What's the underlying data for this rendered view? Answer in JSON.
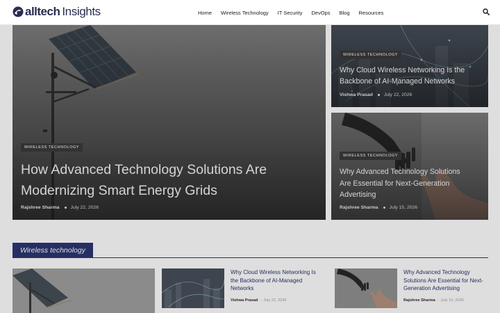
{
  "header": {
    "logo_bold": "alltech",
    "logo_light": "Insights",
    "nav": [
      "Home",
      "Wireless Technology",
      "IT Security",
      "DevOps",
      "Blog",
      "Resources"
    ]
  },
  "hero": {
    "main": {
      "badge": "WIRELESS TECHNOLOGY",
      "title_line1": "How Advanced Technology Solutions Are",
      "title_line2": "Modernizing Smart Energy Grids",
      "author": "Rajshree Sharma",
      "date": "July 22, 2026"
    },
    "top_right": {
      "badge": "WIRELESS TECHNOLOGY",
      "title_line1": "Why Cloud Wireless Networking Is the",
      "title_line2": "Backbone of AI-Managed Networks",
      "author": "Vishwa Prasad",
      "date": "July 22, 2026"
    },
    "bottom_right": {
      "badge": "WIRELESS TECHNOLOGY",
      "title_line1": "Why Advanced Technology Solutions",
      "title_line2": "Are Essential for Next-Generation",
      "title_line3": "Advertising",
      "author": "Rajshree Sharma",
      "date": "July 15, 2026"
    }
  },
  "section": {
    "title": "Wireless technology",
    "posts": [
      {
        "title_line1": "Why Cloud Wireless Networking Is",
        "title_line2": "the Backbone of AI-Managed",
        "title_line3": "Networks",
        "author": "Vishwa Prasad",
        "sep": "-",
        "date": "July 22, 2026"
      },
      {
        "title_line1": "Why Advanced Technology",
        "title_line2": "Solutions Are Essential for Next-",
        "title_line3": "Generation Advertising",
        "author": "Rajshree Sharma",
        "sep": "-",
        "date": "July 15, 2026"
      }
    ]
  },
  "colors": {
    "brand_navy": "#1f2a6b",
    "logo_text": "#2a2d52",
    "badge_bg": "#2e2e2e"
  },
  "icons": {
    "search": "search-icon",
    "logo": "alltech-logo-icon"
  }
}
